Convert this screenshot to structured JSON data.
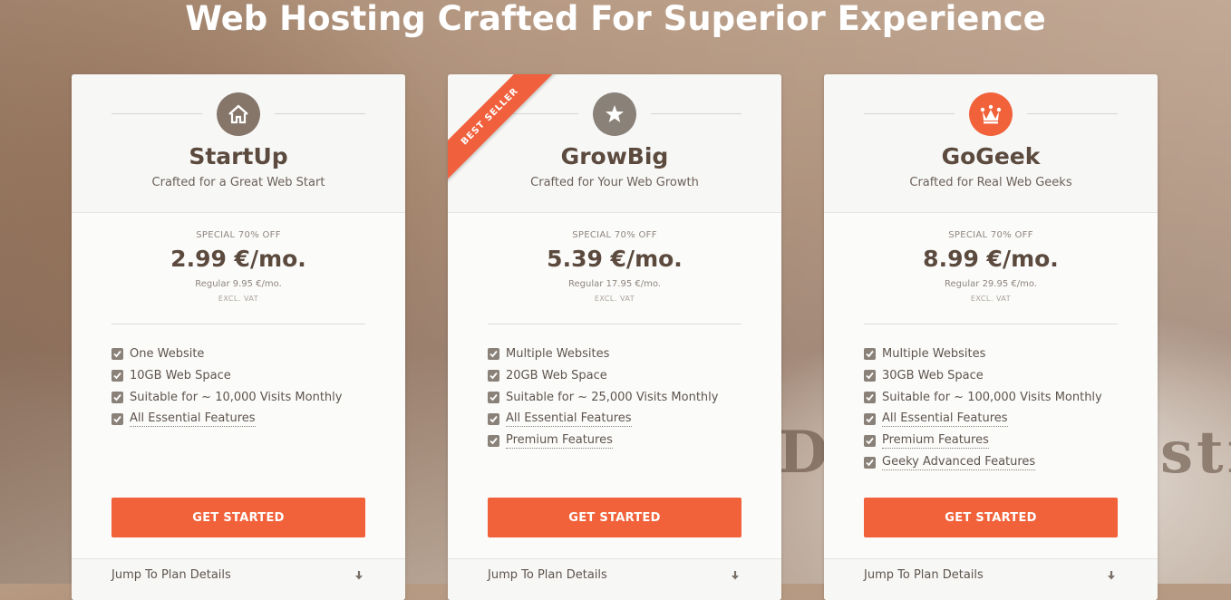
{
  "headline": "Web Hosting Crafted For Superior Experience",
  "background_text": {
    "left": "D",
    "right": "sti"
  },
  "colors": {
    "accent": "#f1623b",
    "brown": "#5b4a3d",
    "icon_gray": "#8a8178",
    "ribbon": "#f1603c"
  },
  "plans": [
    {
      "icon": "house-icon",
      "icon_color": "#86766a",
      "name": "StartUp",
      "tagline": "Crafted for a Great Web Start",
      "special": "SPECIAL 70% OFF",
      "price": "2.99 €/mo.",
      "regular": "Regular 9.95 €/mo.",
      "vat": "EXCL. VAT",
      "features": [
        {
          "label": "One Website",
          "link": false
        },
        {
          "label": "10GB Web Space",
          "link": false
        },
        {
          "label": "Suitable for ~ 10,000 Visits Monthly",
          "link": false
        },
        {
          "label": "All Essential Features",
          "link": true
        }
      ],
      "cta": "GET STARTED",
      "jump": "Jump To Plan Details"
    },
    {
      "icon": "star-icon",
      "icon_color": "#8a8178",
      "ribbon": "BEST SELLER",
      "name": "GrowBig",
      "tagline": "Crafted for Your Web Growth",
      "special": "SPECIAL 70% OFF",
      "price": "5.39 €/mo.",
      "regular": "Regular 17.95 €/mo.",
      "vat": "EXCL. VAT",
      "features": [
        {
          "label": "Multiple Websites",
          "link": false
        },
        {
          "label": "20GB Web Space",
          "link": false
        },
        {
          "label": "Suitable for ~ 25,000 Visits Monthly",
          "link": false
        },
        {
          "label": "All Essential Features",
          "link": true
        },
        {
          "label": "Premium Features",
          "link": true
        }
      ],
      "cta": "GET STARTED",
      "jump": "Jump To Plan Details"
    },
    {
      "icon": "crown-icon",
      "icon_color": "#f1623b",
      "name": "GoGeek",
      "tagline": "Crafted for Real Web Geeks",
      "special": "SPECIAL 70% OFF",
      "price": "8.99 €/mo.",
      "regular": "Regular 29.95 €/mo.",
      "vat": "EXCL. VAT",
      "features": [
        {
          "label": "Multiple Websites",
          "link": false
        },
        {
          "label": "30GB Web Space",
          "link": false
        },
        {
          "label": "Suitable for ~ 100,000 Visits Monthly",
          "link": false
        },
        {
          "label": "All Essential Features",
          "link": true
        },
        {
          "label": "Premium Features",
          "link": true
        },
        {
          "label": "Geeky Advanced Features",
          "link": true
        }
      ],
      "cta": "GET STARTED",
      "jump": "Jump To Plan Details"
    }
  ]
}
